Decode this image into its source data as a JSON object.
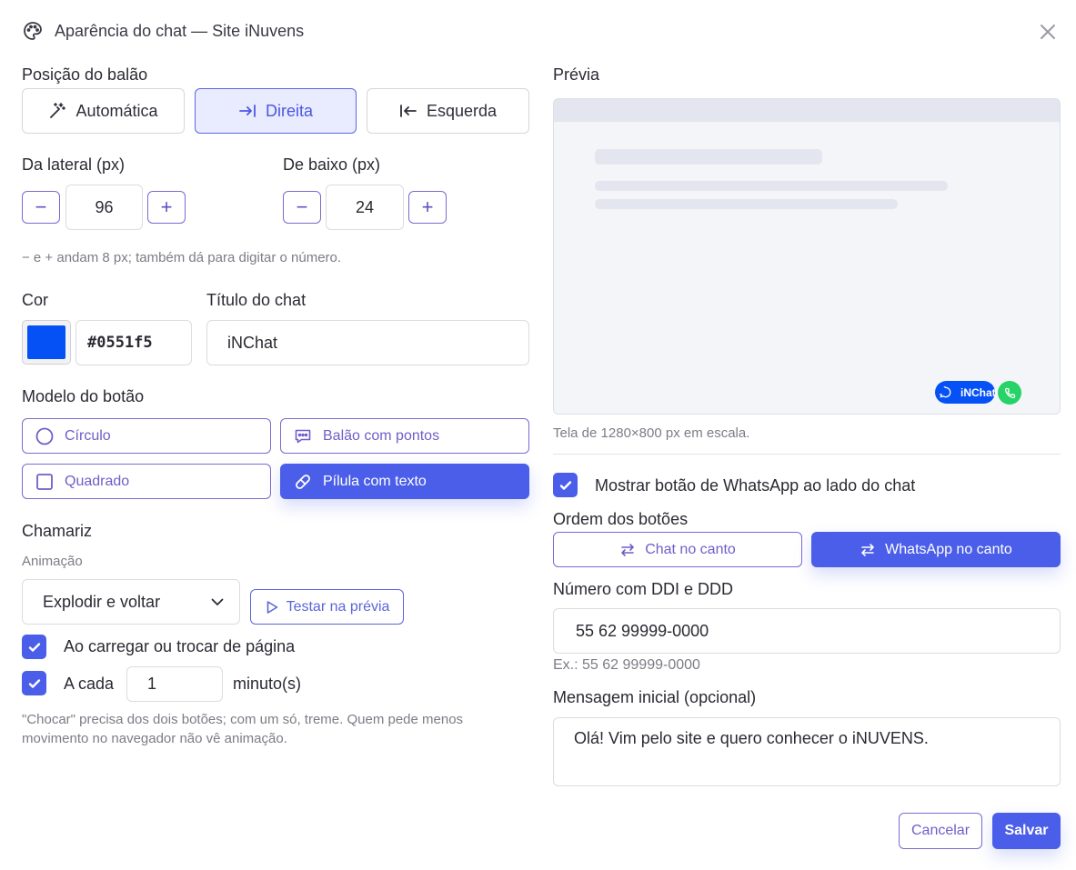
{
  "header": {
    "title": "Aparência do chat — Site iNuvens"
  },
  "position": {
    "label": "Posição do balão",
    "options": [
      "Automática",
      "Direita",
      "Esquerda"
    ],
    "selected": "Direita"
  },
  "offsets": {
    "side_label": "Da lateral (px)",
    "side_value": "96",
    "bottom_label": "De baixo (px)",
    "bottom_value": "24",
    "minus": "−",
    "plus": "+",
    "hint": "− e + andam 8 px; também dá para digitar o número."
  },
  "color": {
    "label": "Cor",
    "value": "#0551f5",
    "swatch": "#0551f5"
  },
  "chat_title": {
    "label": "Título do chat",
    "value": "iNChat"
  },
  "button_model": {
    "label": "Modelo do botão",
    "options": [
      "Círculo",
      "Balão com pontos",
      "Quadrado",
      "Pílula com texto"
    ],
    "selected": "Pílula com texto"
  },
  "lure": {
    "label": "Chamariz",
    "animation_label": "Animação",
    "animation_value": "Explodir e voltar",
    "test_button": "Testar na prévia",
    "on_load_label": "Ao carregar ou trocar de página",
    "on_load_checked": true,
    "every_label": "A cada",
    "every_value": "1",
    "every_unit": "minuto(s)",
    "every_checked": true,
    "note": "\"Chocar\" precisa dos dois botões; com um só, treme. Quem pede menos movimento no navegador não vê animação."
  },
  "preview": {
    "label": "Prévia",
    "pill_text": "iNChat",
    "caption": "Tela de 1280×800 px em escala."
  },
  "whatsapp": {
    "show_label": "Mostrar botão de WhatsApp ao lado do chat",
    "show_checked": true,
    "order_label": "Ordem dos botões",
    "order_options": [
      "Chat no canto",
      "WhatsApp no canto"
    ],
    "order_selected": "WhatsApp no canto",
    "number_label": "Número com DDI e DDD",
    "number_value": "55 62 99999-0000",
    "number_hint": "Ex.: 55 62 99999-0000",
    "message_label": "Mensagem inicial (opcional)",
    "message_value": "Olá! Vim pelo site e quero conhecer o iNUVENS."
  },
  "footer": {
    "cancel": "Cancelar",
    "save": "Salvar"
  },
  "colors": {
    "accent": "#4a5ee9",
    "brand_blue": "#0551f5",
    "whatsapp_green": "#25d366"
  }
}
